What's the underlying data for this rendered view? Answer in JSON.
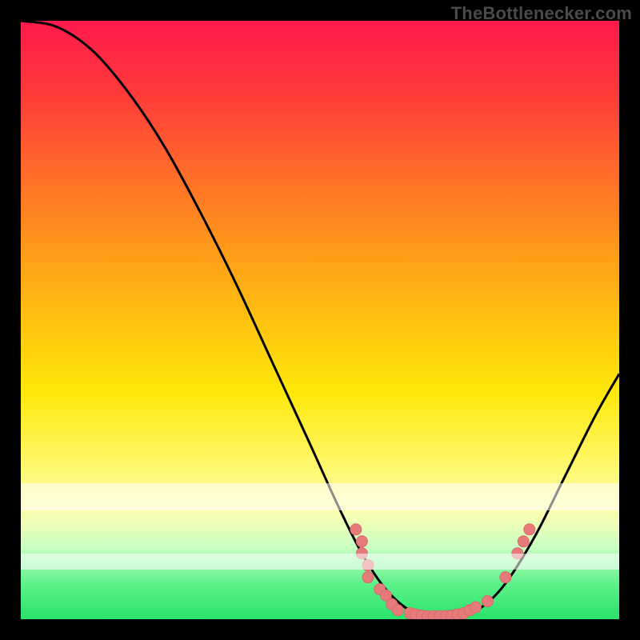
{
  "watermark": "TheBottlenecker.com",
  "colors": {
    "curve": "#000000",
    "dot": "#e77a7a",
    "dot_stroke": "#d86a6a"
  },
  "chart_data": {
    "type": "line",
    "title": "",
    "xlabel": "",
    "ylabel": "",
    "xlim": [
      0,
      100
    ],
    "ylim": [
      0,
      100
    ],
    "curve": [
      {
        "x": 0,
        "y": 100
      },
      {
        "x": 6,
        "y": 99
      },
      {
        "x": 12,
        "y": 95
      },
      {
        "x": 18,
        "y": 88
      },
      {
        "x": 24,
        "y": 79
      },
      {
        "x": 30,
        "y": 68
      },
      {
        "x": 36,
        "y": 56
      },
      {
        "x": 42,
        "y": 43
      },
      {
        "x": 48,
        "y": 30
      },
      {
        "x": 53,
        "y": 19
      },
      {
        "x": 57,
        "y": 11
      },
      {
        "x": 61,
        "y": 5
      },
      {
        "x": 65,
        "y": 1.5
      },
      {
        "x": 69,
        "y": 0.5
      },
      {
        "x": 73,
        "y": 0.5
      },
      {
        "x": 77,
        "y": 2
      },
      {
        "x": 81,
        "y": 6
      },
      {
        "x": 86,
        "y": 14
      },
      {
        "x": 91,
        "y": 24
      },
      {
        "x": 96,
        "y": 34
      },
      {
        "x": 100,
        "y": 41
      }
    ],
    "points": [
      {
        "x": 56,
        "y": 15
      },
      {
        "x": 57,
        "y": 13
      },
      {
        "x": 57,
        "y": 11
      },
      {
        "x": 58,
        "y": 9
      },
      {
        "x": 58,
        "y": 7
      },
      {
        "x": 60,
        "y": 5
      },
      {
        "x": 61,
        "y": 4
      },
      {
        "x": 62,
        "y": 2.5
      },
      {
        "x": 63,
        "y": 1.5
      },
      {
        "x": 65,
        "y": 1
      },
      {
        "x": 66,
        "y": 0.8
      },
      {
        "x": 67,
        "y": 0.6
      },
      {
        "x": 68,
        "y": 0.5
      },
      {
        "x": 69,
        "y": 0.5
      },
      {
        "x": 70,
        "y": 0.5
      },
      {
        "x": 71,
        "y": 0.5
      },
      {
        "x": 72,
        "y": 0.6
      },
      {
        "x": 73,
        "y": 0.8
      },
      {
        "x": 74,
        "y": 1
      },
      {
        "x": 75,
        "y": 1.5
      },
      {
        "x": 76,
        "y": 2
      },
      {
        "x": 78,
        "y": 3
      },
      {
        "x": 81,
        "y": 7
      },
      {
        "x": 83,
        "y": 11
      },
      {
        "x": 84,
        "y": 13
      },
      {
        "x": 85,
        "y": 15
      }
    ]
  }
}
